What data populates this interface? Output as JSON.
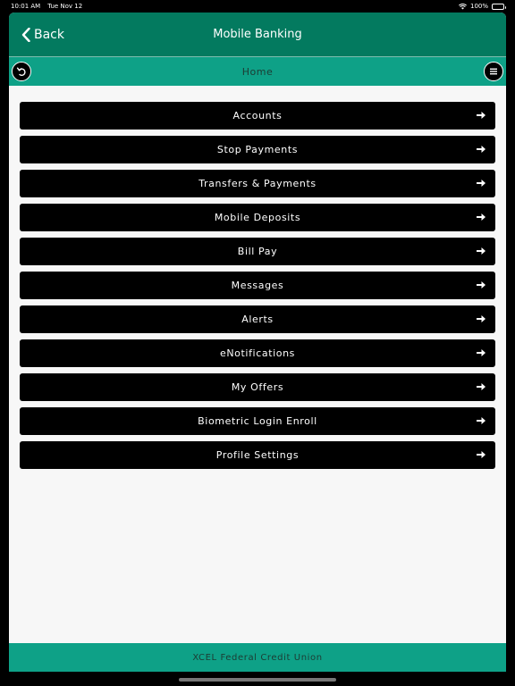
{
  "status_bar": {
    "time": "10:01 AM",
    "date": "Tue Nov 12",
    "battery": "100%"
  },
  "nav": {
    "back_label": "Back",
    "title": "Mobile Banking"
  },
  "sub_nav": {
    "title": "Home"
  },
  "menu": {
    "items": [
      {
        "label": "Accounts"
      },
      {
        "label": "Stop Payments"
      },
      {
        "label": "Transfers & Payments"
      },
      {
        "label": "Mobile Deposits"
      },
      {
        "label": "Bill Pay"
      },
      {
        "label": "Messages"
      },
      {
        "label": "Alerts"
      },
      {
        "label": "eNotifications"
      },
      {
        "label": "My Offers"
      },
      {
        "label": "Biometric Login Enroll"
      },
      {
        "label": "Profile Settings"
      }
    ]
  },
  "footer": {
    "text": "XCEL Federal Credit Union"
  },
  "colors": {
    "nav_bg": "#037a5f",
    "sub_bar_bg": "#0ea187",
    "button_bg": "#000000"
  },
  "icons": {
    "back": "chevron-left-icon",
    "undo": "undo-icon",
    "menu": "hamburger-menu-icon",
    "item_arrow": "arrow-right-icon"
  }
}
